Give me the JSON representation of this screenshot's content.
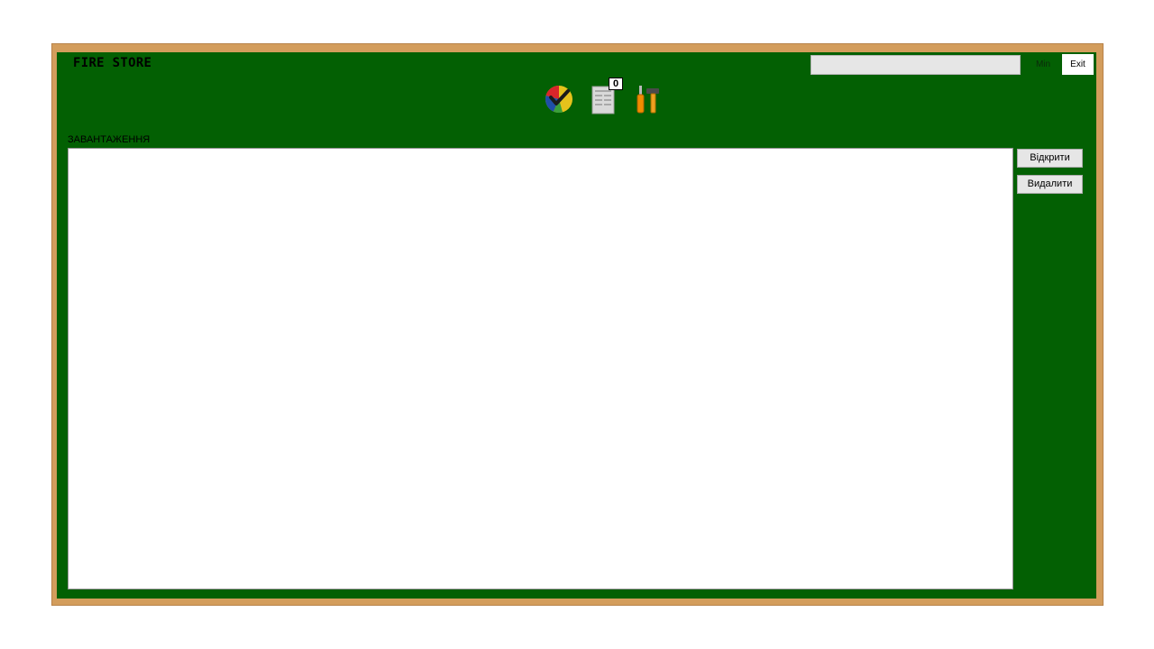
{
  "app": {
    "title": "FIRE STORE"
  },
  "header": {
    "search_value": "",
    "min_label": "Min",
    "exit_label": "Exit"
  },
  "toolbar": {
    "icons": [
      "chart-check-icon",
      "document-list-icon",
      "tools-icon"
    ],
    "document_count": "0"
  },
  "downloads": {
    "label": "ЗАВАНТАЖЕННЯ",
    "items": [],
    "open_label": "Відкрити",
    "delete_label": "Видалити"
  },
  "colors": {
    "background": "#036003",
    "frame": "#d39d5c"
  }
}
